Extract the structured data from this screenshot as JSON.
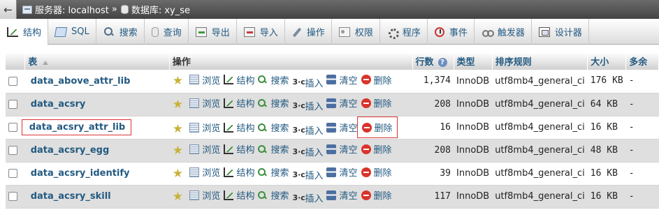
{
  "breadcrumb": {
    "server_label": "服务器: localhost",
    "separator": "»",
    "db_label": "数据库: xy_se",
    "back_glyph": "←"
  },
  "tabs": [
    {
      "label": "结构",
      "icon": "structure-icon",
      "active": true
    },
    {
      "label": "SQL",
      "icon": "sql-icon"
    },
    {
      "label": "搜索",
      "icon": "search-icon"
    },
    {
      "label": "查询",
      "icon": "query-icon"
    },
    {
      "label": "导出",
      "icon": "export-icon"
    },
    {
      "label": "导入",
      "icon": "import-icon"
    },
    {
      "label": "操作",
      "icon": "operations-icon"
    },
    {
      "label": "权限",
      "icon": "privileges-icon"
    },
    {
      "label": "程序",
      "icon": "routines-icon"
    },
    {
      "label": "事件",
      "icon": "events-icon"
    },
    {
      "label": "触发器",
      "icon": "triggers-icon"
    },
    {
      "label": "设计器",
      "icon": "designer-icon"
    }
  ],
  "table": {
    "headers": {
      "table": "表",
      "actions": "操作",
      "rows": "行数",
      "type": "类型",
      "collation": "排序规则",
      "size": "大小",
      "overhead": "多余"
    },
    "actions": {
      "browse": "浏览",
      "structure": "结构",
      "search": "搜索",
      "insert": "插入",
      "empty": "清空",
      "drop": "删除"
    },
    "rows": [
      {
        "name": "data_above_attr_lib",
        "rows": "1,374",
        "type": "InnoDB",
        "collation": "utf8mb4_general_ci",
        "size": "176 KB",
        "overhead": "-"
      },
      {
        "name": "data_acsry",
        "rows": "208",
        "type": "InnoDB",
        "collation": "utf8mb4_general_ci",
        "size": "64 KB",
        "overhead": "-"
      },
      {
        "name": "data_acsry_attr_lib",
        "rows": "16",
        "type": "InnoDB",
        "collation": "utf8mb4_general_ci",
        "size": "16 KB",
        "overhead": "-"
      },
      {
        "name": "data_acsry_egg",
        "rows": "208",
        "type": "InnoDB",
        "collation": "utf8mb4_general_ci",
        "size": "48 KB",
        "overhead": "-"
      },
      {
        "name": "data_acsry_identify",
        "rows": "39",
        "type": "InnoDB",
        "collation": "utf8mb4_general_ci",
        "size": "16 KB",
        "overhead": "-"
      },
      {
        "name": "data_acsry_skill",
        "rows": "117",
        "type": "InnoDB",
        "collation": "utf8mb4_general_ci",
        "size": "16 KB",
        "overhead": "-"
      }
    ]
  },
  "colors": {
    "link": "#235a81",
    "highlight_border": "#dd3333",
    "row_alt": "#dfdfdf"
  }
}
